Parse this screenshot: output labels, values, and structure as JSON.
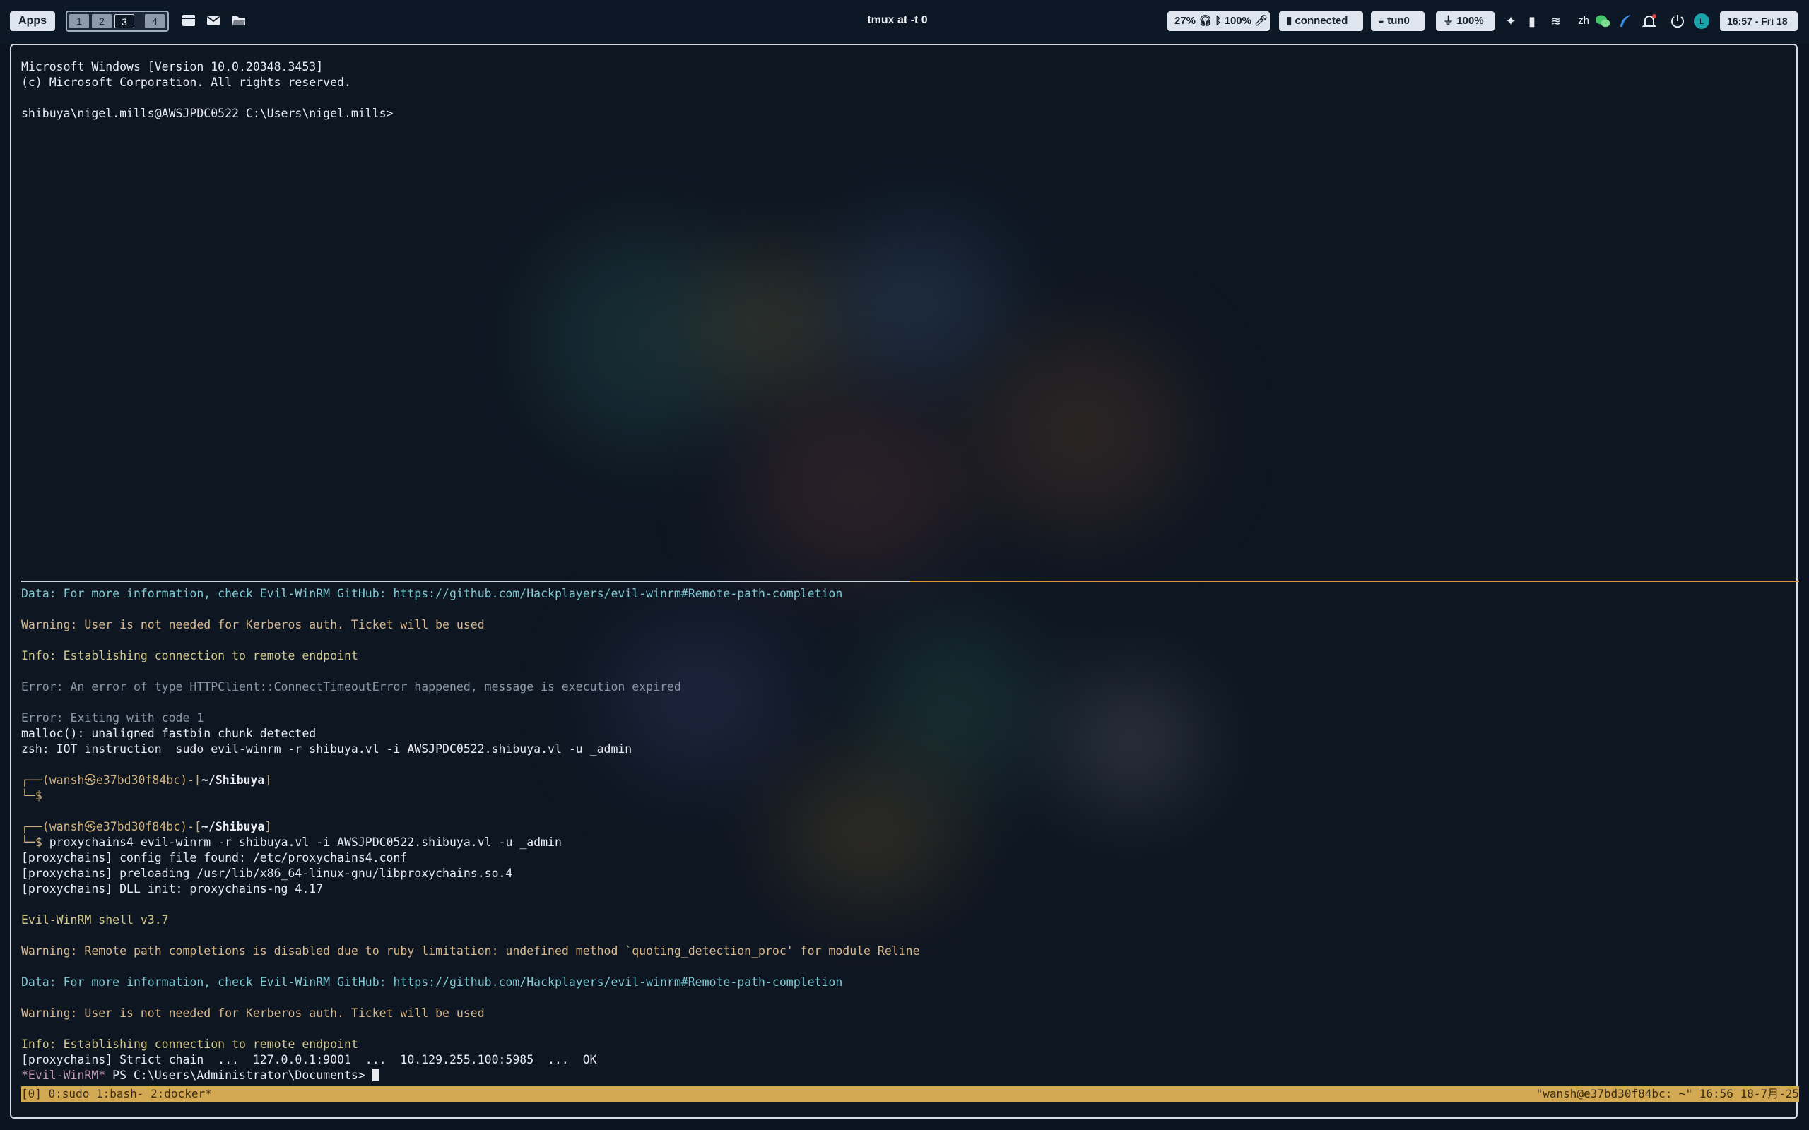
{
  "topbar": {
    "apps_label": "Apps",
    "workspaces": [
      "1",
      "2",
      "3",
      "4"
    ],
    "active_workspace": "3",
    "window_title": "tmux at -t 0",
    "status": {
      "battery_percent": "27%",
      "volume_percent": "100%",
      "bluetooth_status": "connected",
      "vpn_interface": "tun0",
      "power_percent": "100%",
      "input_method": "zh",
      "clock": "16:57 - Fri 18"
    }
  },
  "terminal": {
    "top_pane": [
      {
        "text": "Microsoft Windows [Version 10.0.20348.3453]",
        "kind": "white"
      },
      {
        "text": "(c) Microsoft Corporation. All rights reserved.",
        "kind": "white"
      },
      {
        "text": "",
        "kind": "white"
      },
      {
        "text": "shibuya\\nigel.mills@AWSJPDC0522 C:\\Users\\nigel.mills>",
        "kind": "white"
      }
    ],
    "bottom_pane": [
      {
        "text": "Data: For more information, check Evil-WinRM GitHub: https://github.com/Hackplayers/evil-winrm#Remote-path-completion",
        "kind": "data"
      },
      {
        "text": "",
        "kind": "white"
      },
      {
        "text": "Warning: User is not needed for Kerberos auth. Ticket will be used",
        "kind": "warn"
      },
      {
        "text": "",
        "kind": "white"
      },
      {
        "text": "Info: Establishing connection to remote endpoint",
        "kind": "info"
      },
      {
        "text": "",
        "kind": "white"
      },
      {
        "text": "Error: An error of type HTTPClient::ConnectTimeoutError happened, message is execution expired",
        "kind": "err"
      },
      {
        "text": "",
        "kind": "white"
      },
      {
        "text": "Error: Exiting with code 1",
        "kind": "err"
      },
      {
        "text": "malloc(): unaligned fastbin chunk detected",
        "kind": "white"
      },
      {
        "text": "zsh: IOT instruction  sudo evil-winrm -r shibuya.vl -i AWSJPDC0522.shibuya.vl -u _admin",
        "kind": "white"
      },
      {
        "text": "",
        "kind": "white"
      },
      {
        "text": "┌──(wansh㉿e37bd30f84bc)-[~/Shibuya]",
        "kind": "prompt1"
      },
      {
        "text": "└─$",
        "kind": "prompt2",
        "cmd": ""
      },
      {
        "text": "",
        "kind": "white"
      },
      {
        "text": "┌──(wansh㉿e37bd30f84bc)-[~/Shibuya]",
        "kind": "prompt1"
      },
      {
        "text": "└─$",
        "kind": "prompt2",
        "cmd": " proxychains4 evil-winrm -r shibuya.vl -i AWSJPDC0522.shibuya.vl -u _admin"
      },
      {
        "text": "[proxychains] config file found: /etc/proxychains4.conf",
        "kind": "white"
      },
      {
        "text": "[proxychains] preloading /usr/lib/x86_64-linux-gnu/libproxychains.so.4",
        "kind": "white"
      },
      {
        "text": "[proxychains] DLL init: proxychains-ng 4.17",
        "kind": "white"
      },
      {
        "text": "",
        "kind": "white"
      },
      {
        "text": "Evil-WinRM shell v3.7",
        "kind": "info"
      },
      {
        "text": "",
        "kind": "white"
      },
      {
        "text": "Warning: Remote path completions is disabled due to ruby limitation: undefined method `quoting_detection_proc' for module Reline",
        "kind": "warn"
      },
      {
        "text": "",
        "kind": "white"
      },
      {
        "text": "Data: For more information, check Evil-WinRM GitHub: https://github.com/Hackplayers/evil-winrm#Remote-path-completion",
        "kind": "data"
      },
      {
        "text": "",
        "kind": "white"
      },
      {
        "text": "Warning: User is not needed for Kerberos auth. Ticket will be used",
        "kind": "warn"
      },
      {
        "text": "",
        "kind": "white"
      },
      {
        "text": "Info: Establishing connection to remote endpoint",
        "kind": "info"
      },
      {
        "text": "[proxychains] Strict chain  ...  127.0.0.1:9001  ...  10.129.255.100:5985  ...  OK",
        "kind": "white"
      },
      {
        "text": "*Evil-WinRM* PS C:\\Users\\Administrator\\Documents> ",
        "kind": "ps"
      }
    ],
    "ps_prefix": "*Evil-WinRM*",
    "ps_rest": " PS C:\\Users\\Administrator\\Documents> "
  },
  "tmux_status": {
    "left": "[0] 0:sudo  1:bash- 2:docker*",
    "right": "\"wansh@e37bd30f84bc: ~\" 16:56 18-7月-25"
  },
  "colors": {
    "accent": "#d3a853",
    "background": "#0b1420"
  },
  "icons": [
    "window-icon",
    "mail-icon",
    "folder-icon",
    "headphones-icon",
    "bluetooth-icon",
    "mic-icon",
    "shield-icon",
    "vpn-icon",
    "plug-icon",
    "tools-icon",
    "bars-chart-icon",
    "layers-icon",
    "wechat-icon",
    "feather-icon",
    "bell-icon",
    "power-icon",
    "avatar-icon"
  ]
}
